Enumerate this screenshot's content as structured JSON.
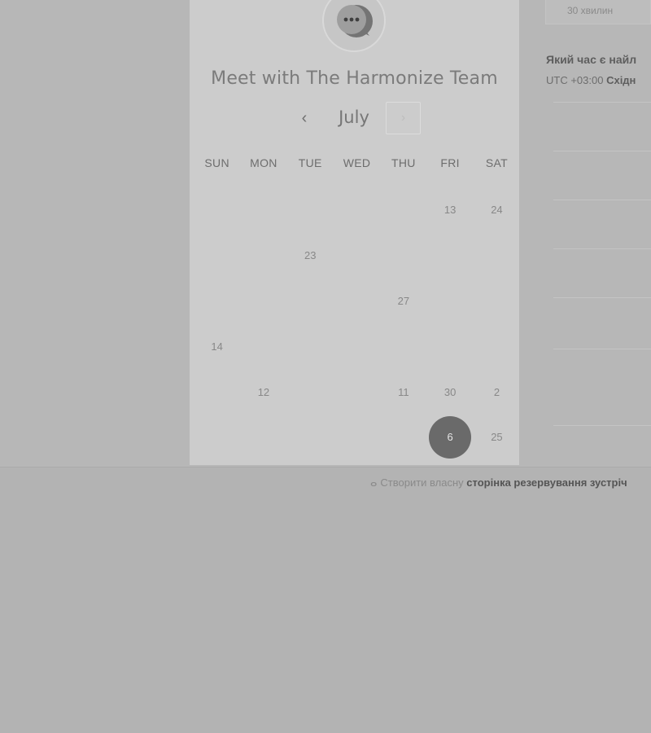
{
  "meeting": {
    "title": "Meet with The Harmonize Team",
    "avatar_icon": "chat-bubble-icon"
  },
  "calendar": {
    "month": "July",
    "prev_icon": "‹",
    "next_icon": "›",
    "weekdays": [
      "SUN",
      "MON",
      "TUE",
      "WED",
      "THU",
      "FRI",
      "SAT"
    ],
    "weeks": [
      [
        "",
        "",
        "",
        "",
        "",
        "13",
        "24"
      ],
      [
        "",
        "",
        "23",
        "",
        "",
        "",
        ""
      ],
      [
        "",
        "",
        "",
        "",
        "27",
        "",
        ""
      ],
      [
        "14",
        "",
        "",
        "",
        "",
        "",
        ""
      ],
      [
        "",
        "12",
        "",
        "",
        "11",
        "30",
        "2"
      ],
      [
        "",
        "",
        "",
        "",
        "",
        "6",
        "25"
      ]
    ],
    "selected_day": "6"
  },
  "right_panel": {
    "duration_label": "30 хвилин",
    "question": "Який час є найл",
    "timezone_prefix": "UTC +03:00",
    "timezone_name": "Східн"
  },
  "footer": {
    "brand_icon": "hubspot-sprocket-icon",
    "prefix": "Створити власну",
    "link_text": "сторінка резервування зустріч"
  }
}
